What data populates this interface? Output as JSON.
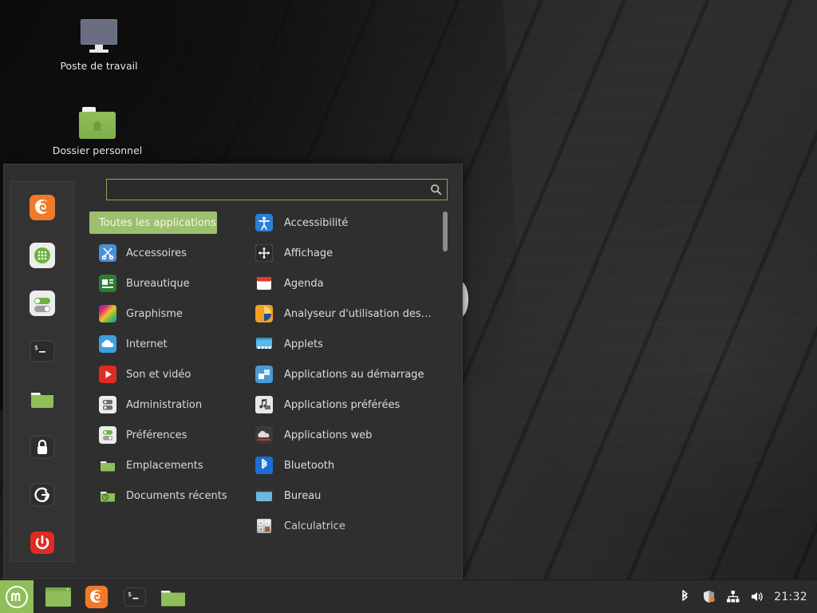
{
  "desktop": {
    "icons": [
      {
        "label": "Poste de travail",
        "icon": "computer-icon"
      },
      {
        "label": "Dossier personnel",
        "icon": "home-folder-icon"
      }
    ]
  },
  "menu": {
    "search": {
      "value": "",
      "placeholder": "",
      "icon": "search-icon"
    },
    "favorites": [
      {
        "name": "firefox-icon",
        "label": "Firefox"
      },
      {
        "name": "software-manager-icon",
        "label": "Gestionnaire de logiciels"
      },
      {
        "name": "system-settings-icon",
        "label": "Paramètres système"
      },
      {
        "name": "terminal-icon",
        "label": "Terminal"
      },
      {
        "name": "files-icon",
        "label": "Fichiers"
      },
      {
        "name": "lock-screen-icon",
        "label": "Verrouiller l'écran"
      },
      {
        "name": "logout-icon",
        "label": "Fermer la session"
      },
      {
        "name": "shutdown-icon",
        "label": "Éteindre"
      }
    ],
    "categories": [
      {
        "label": "Toutes les applications",
        "icon": "all-applications-icon",
        "selected": true
      },
      {
        "label": "Accessoires",
        "icon": "accessories-icon",
        "selected": false
      },
      {
        "label": "Bureautique",
        "icon": "office-icon",
        "selected": false
      },
      {
        "label": "Graphisme",
        "icon": "graphics-icon",
        "selected": false
      },
      {
        "label": "Internet",
        "icon": "internet-icon",
        "selected": false
      },
      {
        "label": "Son et vidéo",
        "icon": "sound-video-icon",
        "selected": false
      },
      {
        "label": "Administration",
        "icon": "administration-icon",
        "selected": false
      },
      {
        "label": "Préférences",
        "icon": "preferences-icon",
        "selected": false
      },
      {
        "label": "Emplacements",
        "icon": "places-icon",
        "selected": false
      },
      {
        "label": "Documents récents",
        "icon": "recent-documents-icon",
        "selected": false
      }
    ],
    "applications": [
      {
        "label": "Accessibilité",
        "icon": "accessibility-icon"
      },
      {
        "label": "Affichage",
        "icon": "display-icon"
      },
      {
        "label": "Agenda",
        "icon": "calendar-icon"
      },
      {
        "label": "Analyseur d'utilisation des…",
        "icon": "disk-usage-analyzer-icon"
      },
      {
        "label": "Applets",
        "icon": "applets-icon"
      },
      {
        "label": "Applications au démarrage",
        "icon": "startup-applications-icon"
      },
      {
        "label": "Applications préférées",
        "icon": "preferred-applications-icon"
      },
      {
        "label": "Applications web",
        "icon": "web-apps-icon"
      },
      {
        "label": "Bluetooth",
        "icon": "bluetooth-icon"
      },
      {
        "label": "Bureau",
        "icon": "desktop-icon"
      },
      {
        "label": "Calculatrice",
        "icon": "calculator-icon"
      }
    ]
  },
  "taskbar": {
    "menu_button": {
      "label": "Menu",
      "icon": "linux-mint-logo-icon"
    },
    "windows": [
      {
        "name": "window-button-files",
        "icon": "green-window-icon"
      },
      {
        "name": "window-button-firefox",
        "icon": "firefox-icon"
      },
      {
        "name": "window-button-terminal",
        "icon": "terminal-icon"
      },
      {
        "name": "window-button-folder",
        "icon": "folder-icon"
      }
    ],
    "tray": [
      {
        "name": "bluetooth-tray-icon"
      },
      {
        "name": "update-shield-tray-icon"
      },
      {
        "name": "network-tray-icon"
      },
      {
        "name": "volume-tray-icon"
      }
    ],
    "clock": "21:32"
  },
  "colors": {
    "accent_green": "#8fbe5a",
    "selection_green": "#9ec06e",
    "panel_bg": "#2f2f2f",
    "taskbar_bg": "#2b2b2b",
    "text": "#dcdcdc"
  }
}
